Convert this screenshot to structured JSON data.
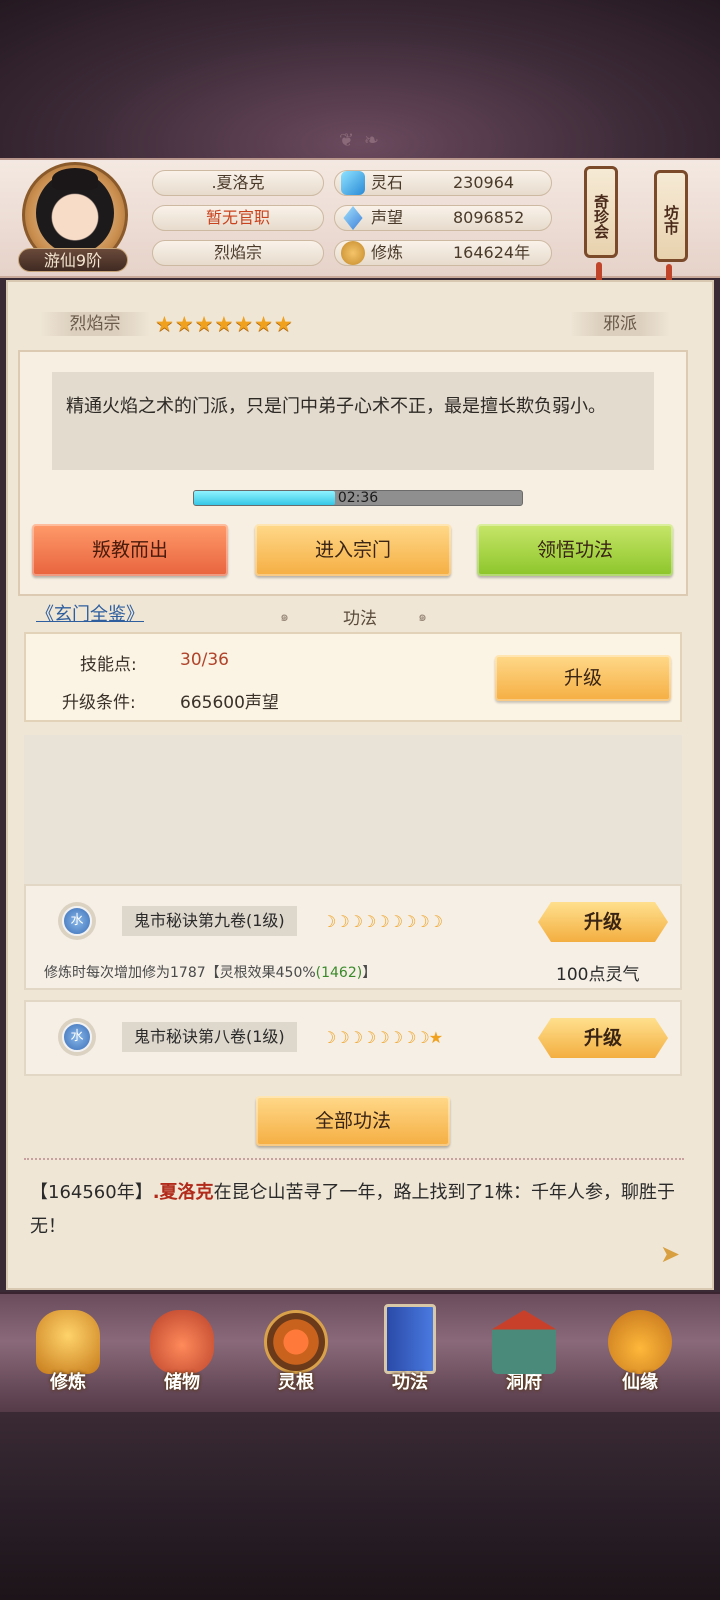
{
  "player": {
    "name": ".夏洛克",
    "office": "暂无官职",
    "sect": "烈焰宗",
    "rank": "游仙9阶"
  },
  "stats": [
    {
      "label": "灵石",
      "value": "230964",
      "icon": "spirit-stone-icon"
    },
    {
      "label": "声望",
      "value": "8096852",
      "icon": "reputation-crystal-icon"
    },
    {
      "label": "修炼",
      "value": "164624年",
      "icon": "meditation-icon"
    }
  ],
  "side_buttons": {
    "treasure": "奇珍会",
    "market": "坊市"
  },
  "sect_panel": {
    "name": "烈焰宗",
    "stars": "★★★★★★★",
    "star_count": 7,
    "alignment": "邪派",
    "description": "精通火焰之术的门派，只是门中弟子心术不正，最是擅长欺负弱小。",
    "timer": "02:36",
    "timer_progress": 0.43
  },
  "action_buttons": {
    "leave": "叛教而出",
    "enter": "进入宗门",
    "comprehend": "领悟功法"
  },
  "encyclopedia_link": "《玄门全鉴》",
  "tab_title": "功法",
  "skill_points": {
    "label": "技能点:",
    "value": "30/36",
    "cond_label": "升级条件:",
    "cond_value": "665600声望",
    "upgrade": "升级"
  },
  "skills": [
    {
      "element": "水",
      "name": "鬼市秘诀第九卷(1级)",
      "level_marks": "☽☽☽☽☽☽☽☽☽",
      "upgrade": "升级",
      "effect_prefix": "修炼时每次增加修为1787【灵根效果450%",
      "effect_bonus": "(1462)",
      "effect_suffix": "】",
      "cost": "100点灵气"
    },
    {
      "element": "水",
      "name": "鬼市秘诀第八卷(1级)",
      "level_marks": "☽☽☽☽☽☽☽☽★",
      "upgrade": "升级"
    }
  ],
  "all_skills_button": "全部功法",
  "log": {
    "year": "【164560年】",
    "name": ".夏洛克",
    "text": "在昆仑山苦寻了一年，路上找到了1株：千年人参，聊胜于无！"
  },
  "nav": [
    {
      "label": "修炼",
      "icon": "monk-icon"
    },
    {
      "label": "储物",
      "icon": "bag-icon"
    },
    {
      "label": "灵根",
      "icon": "spirit-root-icon"
    },
    {
      "label": "功法",
      "icon": "book-icon"
    },
    {
      "label": "洞府",
      "icon": "cave-house-icon"
    },
    {
      "label": "仙缘",
      "icon": "gourd-icon"
    }
  ],
  "colors": {
    "accent_gold": "#f5ae42",
    "danger_red": "#e8633e",
    "green_btn": "#8cc52a",
    "link_blue": "#2e5e9e"
  }
}
